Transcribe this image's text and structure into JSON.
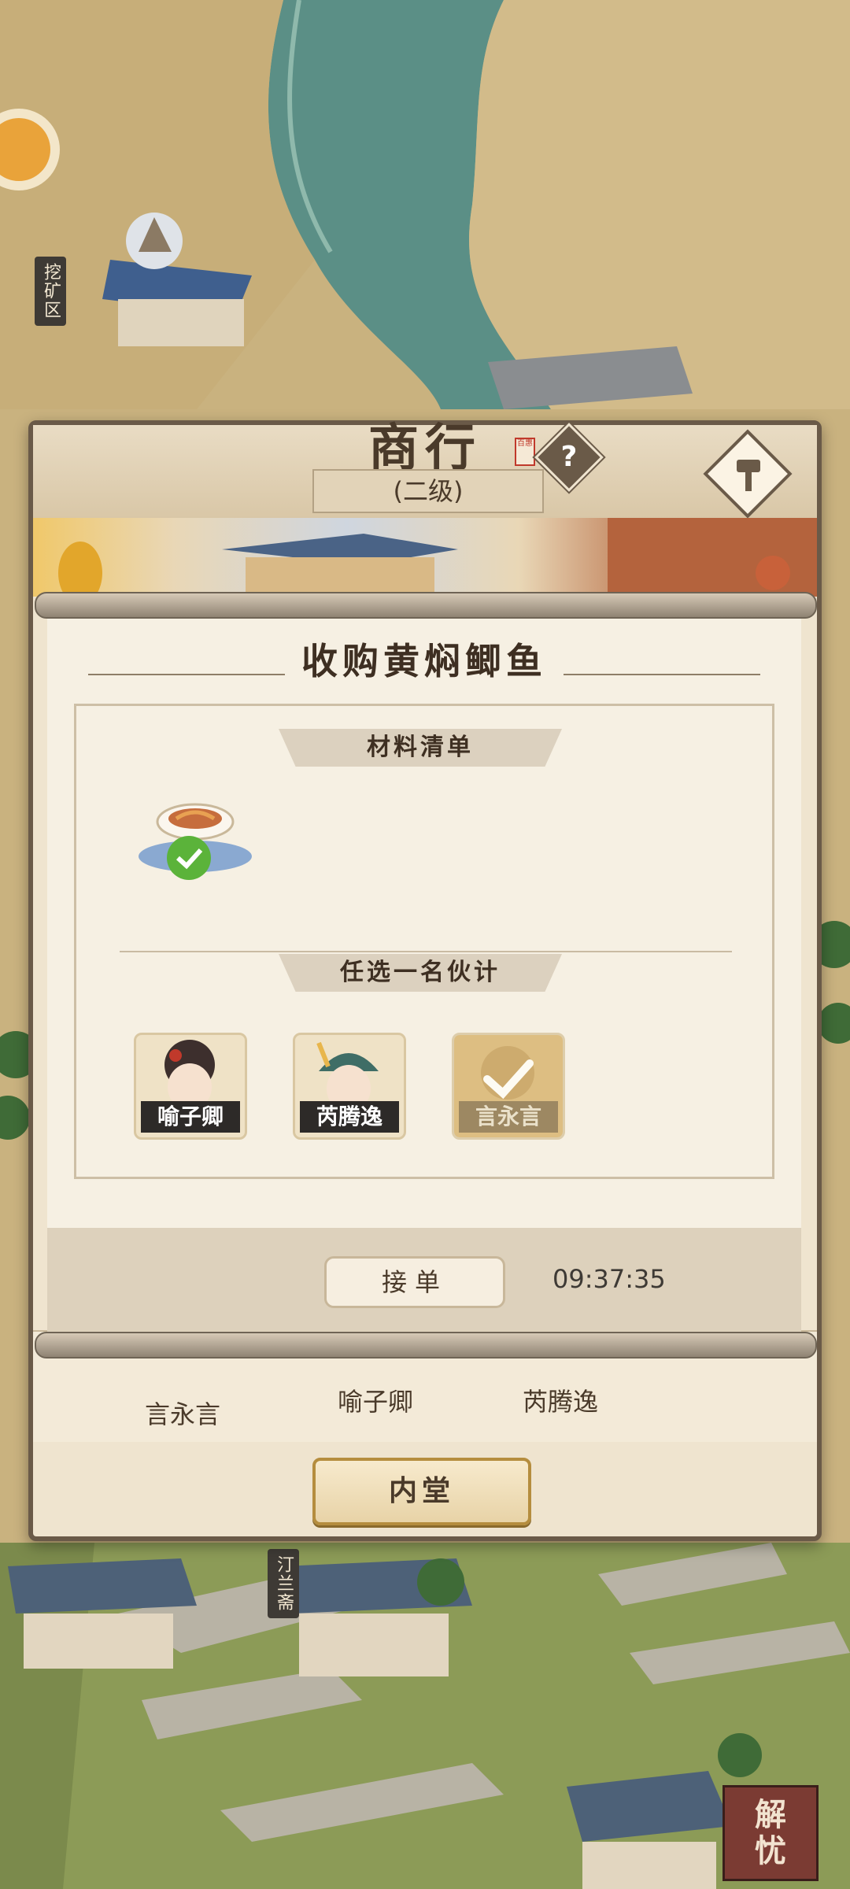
{
  "map": {
    "mining_area_label": "挖矿区",
    "tinglan_label": "汀兰斋"
  },
  "panel": {
    "title": "商行",
    "title_seal": "百惠",
    "help_icon": "?",
    "level": "(二级)",
    "inner_hall_label": "内堂",
    "bottom_staff": [
      "言永言",
      "喻子卿",
      "芮腾逸"
    ]
  },
  "dialog": {
    "title": "收购黄焖鲫鱼",
    "materials_header": "材料清单",
    "choose_staff_header": "任选一名伙计",
    "staff": [
      {
        "name": "喻子卿",
        "selected": false
      },
      {
        "name": "芮腾逸",
        "selected": false
      },
      {
        "name": "言永言",
        "selected": true
      }
    ],
    "accept_label": "接单",
    "countdown": "09:37:35"
  },
  "corner_badge": {
    "line1": "解",
    "line2": "忧"
  },
  "colors": {
    "panel_border": "#6a5a48",
    "accent_gold": "#b58d3e",
    "check_green": "#5bb33a"
  }
}
